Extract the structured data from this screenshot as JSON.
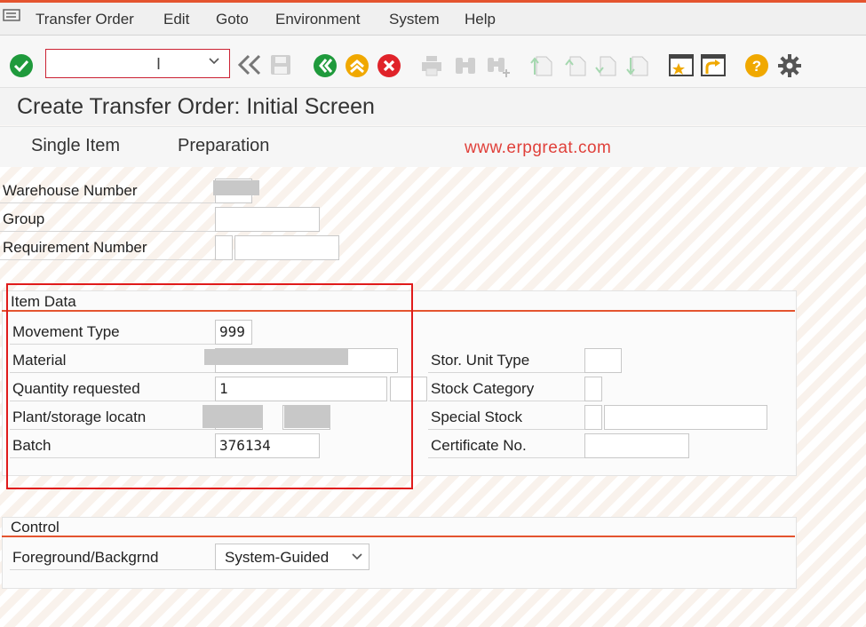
{
  "menu": {
    "items": [
      {
        "label": "Transfer Order"
      },
      {
        "label": "Edit"
      },
      {
        "label": "Goto"
      },
      {
        "label": "Environment"
      },
      {
        "label": "System"
      },
      {
        "label": "Help"
      }
    ]
  },
  "toolbar": {
    "command_field": {
      "value": "",
      "placeholder": ""
    },
    "icons": [
      "enter-icon",
      "dropdown-caret-icon",
      "back-history-icon",
      "save-icon",
      "back-icon",
      "exit-icon",
      "cancel-icon",
      "print-icon",
      "find-icon",
      "find-next-icon",
      "first-page-icon",
      "previous-page-icon",
      "next-page-icon",
      "last-page-icon",
      "create-session-icon",
      "generate-shortcut-icon",
      "help-icon",
      "settings-gear-icon"
    ],
    "colors": {
      "enter": "#1f9a3c",
      "back": "#1f9a3c",
      "exit": "#f0a800",
      "cancel": "#e0232a",
      "help": "#f0a800"
    }
  },
  "title": {
    "text": "Create Transfer Order: Initial Screen"
  },
  "app_toolbar": {
    "buttons": [
      {
        "label": "Single Item"
      },
      {
        "label": "Preparation"
      }
    ]
  },
  "watermark": {
    "text": "www.erpgreat.com"
  },
  "header_fields": {
    "warehouse_number": {
      "label": "Warehouse Number",
      "value": ""
    },
    "group": {
      "label": "Group",
      "value": ""
    },
    "requirement_number": {
      "label": "Requirement Number",
      "value": ""
    }
  },
  "item_data": {
    "title": "Item Data",
    "movement_type": {
      "label": "Movement Type",
      "value": "999"
    },
    "material": {
      "label": "Material",
      "value": ""
    },
    "quantity_requested": {
      "label": "Quantity requested",
      "value": "1",
      "unit": ""
    },
    "plant_storage": {
      "label": "Plant/storage locatn",
      "value": ""
    },
    "batch": {
      "label": "Batch",
      "value": "376134"
    },
    "stor_unit_type": {
      "label": "Stor. Unit Type",
      "value": ""
    },
    "stock_category": {
      "label": "Stock Category",
      "value": ""
    },
    "special_stock": {
      "label": "Special Stock",
      "value": ""
    },
    "certificate_no": {
      "label": "Certificate No.",
      "value": ""
    }
  },
  "control": {
    "title": "Control",
    "foreground_background": {
      "label": "Foreground/Backgrnd",
      "value": "System-Guided"
    }
  },
  "colors": {
    "accent": "#e4542f",
    "highlight": "#e01b1b",
    "watermark": "#e0403a"
  }
}
